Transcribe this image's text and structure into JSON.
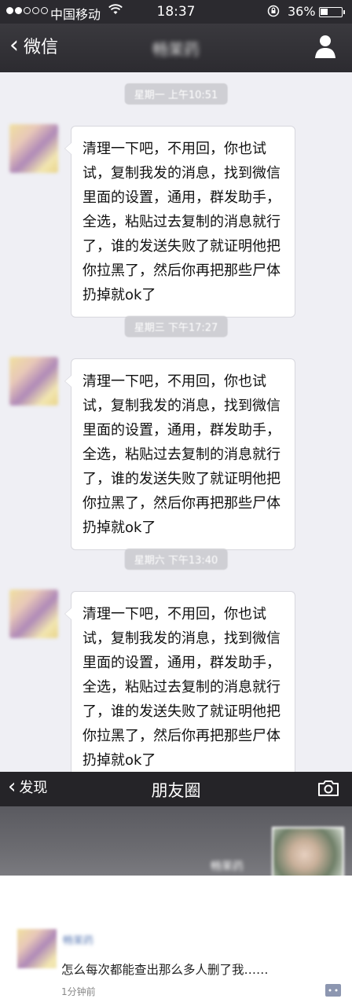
{
  "status_bar": {
    "carrier": "中国移动",
    "time": "18:37",
    "battery_percent": "36%",
    "battery_level": 0.36,
    "signal_bars_filled": 2,
    "signal_bars_total": 5,
    "icons": [
      "wifi-icon",
      "rotation-lock-icon",
      "battery-icon"
    ]
  },
  "chat_header": {
    "back_label": "微信",
    "title": "畅茉药",
    "icons": [
      "chevron-left-icon",
      "person-icon"
    ]
  },
  "messages": [
    {
      "timestamp": "星期一 上午10:51",
      "text": "清理一下吧，不用回，你也试试，复制我发的消息，找到微信里面的设置，通用，群发助手，全选，粘贴过去复制的消息就行了，谁的发送失败了就证明他把你拉黑了，然后你再把那些尸体扔掉就ok了"
    },
    {
      "timestamp": "星期三 下午17:27",
      "text": "清理一下吧，不用回，你也试试，复制我发的消息，找到微信里面的设置，通用，群发助手，全选，粘贴过去复制的消息就行了，谁的发送失败了就证明他把你拉黑了，然后你再把那些尸体扔掉就ok了"
    },
    {
      "timestamp": "星期六 下午13:40",
      "text": "清理一下吧，不用回，你也试试，复制我发的消息，找到微信里面的设置，通用，群发助手，全选，粘贴过去复制的消息就行了，谁的发送失败了就证明他把你拉黑了，然后你再把那些尸体扔掉就ok了"
    }
  ],
  "moments_header": {
    "back_label": "发现",
    "title": "朋友圈",
    "icons": [
      "chevron-left-icon",
      "camera-icon"
    ]
  },
  "moments": {
    "cover_name": "畅茉药",
    "post": {
      "author": "畅茉药",
      "text": "怎么每次都能查出那么多人删了我……",
      "time": "1分钟前"
    }
  },
  "colors": {
    "header_dark": "#2c2b30",
    "chat_background": "#efeff4",
    "bubble": "#ffffff",
    "link_blue": "#5b7bb5"
  }
}
